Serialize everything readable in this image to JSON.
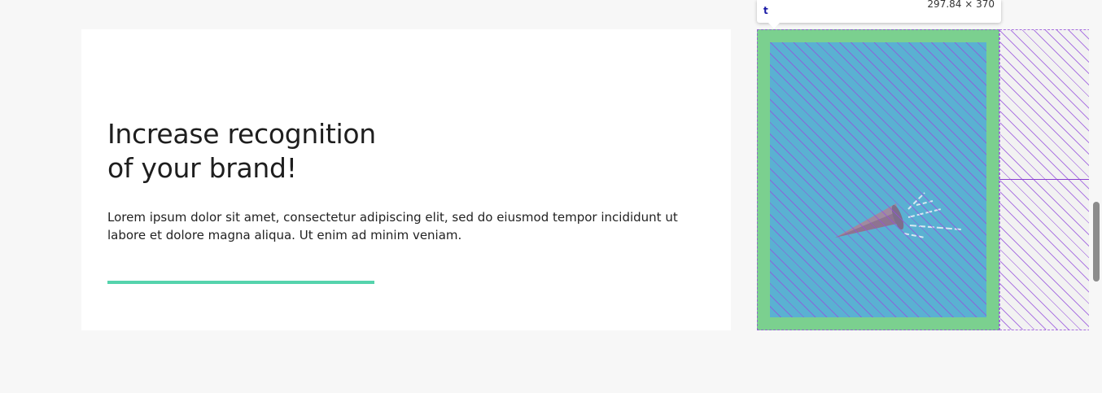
{
  "card": {
    "headline_line1": "Increase recognition",
    "headline_line2": "of your brand!",
    "body": "Lorem ipsum dolor sit amet, consectetur adipiscing elit, sed do eiusmod tempor incididunt ut labore et dolore magna aliqua. Ut enim ad minim veniam."
  },
  "inspector": {
    "element_name": "t",
    "dimensions": "297.84 × 370"
  },
  "colors": {
    "accent": "#55d3ac",
    "margin": "#7bd08f",
    "content": "#5ab1d2",
    "hatch": "#9650dc"
  }
}
